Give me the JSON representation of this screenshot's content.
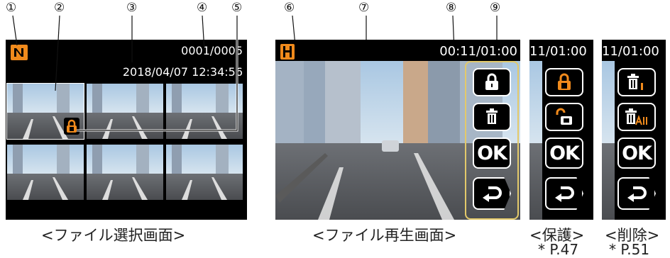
{
  "callouts": [
    "①",
    "②",
    "③",
    "④",
    "⑤",
    "⑥",
    "⑦",
    "⑧",
    "⑨"
  ],
  "select_screen": {
    "counter": "0001/0005",
    "datetime": "2018/04/07  12:34:56",
    "caption": "<ファイル選択画面>"
  },
  "play_screen": {
    "time": "00:11/01:00",
    "caption": "<ファイル再生画面>",
    "buttons": [
      "lock-icon",
      "trash-icon",
      "OK",
      "back-icon"
    ]
  },
  "protect_screen": {
    "time": "11/01:00",
    "caption": "<保護>",
    "ref": "*  P.47",
    "buttons": [
      "lock-icon",
      "unlock-icon",
      "OK",
      "back-icon"
    ]
  },
  "delete_screen": {
    "time": "11/01:00",
    "caption": "<削除>",
    "ref": "*  P.51",
    "buttons": [
      "trash-one-icon",
      "trash-all-icon",
      "OK",
      "back-icon"
    ]
  },
  "ok_label": "OK",
  "colors": {
    "accent_orange": "#f08a1c",
    "highlight_border": "#e3c96a"
  }
}
